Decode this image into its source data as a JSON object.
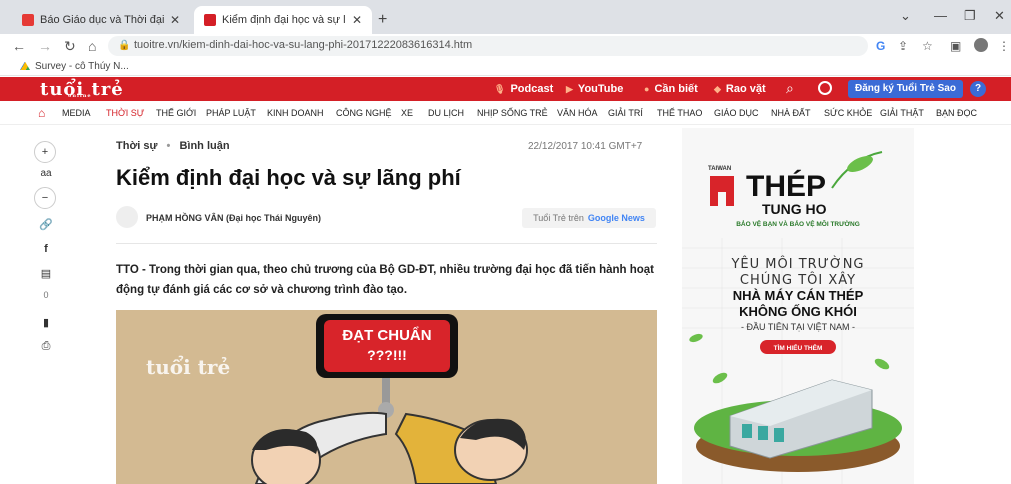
{
  "browser": {
    "tabs": [
      {
        "title": "Báo Giáo dục và Thời đại Online",
        "active": false
      },
      {
        "title": "Kiểm định đại học và sự lãng phí",
        "active": true
      }
    ],
    "url": "tuoitre.vn/kiem-dinh-dai-hoc-va-su-lang-phi-20171222083616314.htm",
    "bookmark": "Survey - cô Thúy N..."
  },
  "site": {
    "logo": "tuổi trẻ",
    "logo_sub": "online",
    "topnav": [
      "Podcast",
      "YouTube",
      "Cần biết",
      "Rao vặt"
    ],
    "subscribe": "Đăng ký Tuổi Trẻ Sao",
    "help": "?",
    "categories": [
      "MEDIA",
      "THỜI SỰ",
      "THẾ GIỚI",
      "PHÁP LUẬT",
      "KINH DOANH",
      "CÔNG NGHỆ",
      "XE",
      "DU LỊCH",
      "NHỊP SỐNG TRẺ",
      "VĂN HÓA",
      "GIẢI TRÍ",
      "THỂ THAO",
      "GIÁO DỤC",
      "NHÀ ĐẤT",
      "SỨC KHỎE",
      "GIẢI THẬT",
      "BẠN ĐỌC"
    ],
    "active_category": "THỜI SỰ"
  },
  "tools": {
    "font_plus": "+",
    "font_label": "aa",
    "font_minus": "−",
    "comment_count": "0"
  },
  "article": {
    "section": "Thời sự",
    "subsection": "Bình luận",
    "date": "22/12/2017 10:41 GMT+7",
    "title": "Kiểm định đại học và sự lãng phí",
    "author": "PHẠM HỒNG VÂN (Đại học Thái Nguyên)",
    "gnews_prefix": "Tuổi Trẻ trên",
    "gnews_brand": "Google News",
    "lead": "TTO - Trong thời gian qua, theo chủ trương của Bộ GD-ĐT, nhiều trường đại học đã tiến hành hoạt động tự đánh giá các cơ sở và chương trình đào tạo.",
    "image_sign_line1": "ĐẠT CHUẨN",
    "image_sign_line2": "???!!!",
    "image_watermark": "tuổi trẻ"
  },
  "ad": {
    "brand_top": "TAIWAN",
    "brand_main": "THÉP",
    "brand_sub": "TUNG HO",
    "tagline": "BẢO VỆ BẠN VÀ BẢO VỆ MÔI TRƯỜNG",
    "line1": "YÊU MÔI TRƯỜNG",
    "line2": "CHÚNG TÔI XÂY",
    "line3": "NHÀ MÁY CÁN THÉP",
    "line4": "KHÔNG ỐNG KHÓI",
    "line5": "- ĐẦU TIÊN TẠI VIỆT NAM -",
    "cta": "TÌM HIỂU THÊM"
  }
}
